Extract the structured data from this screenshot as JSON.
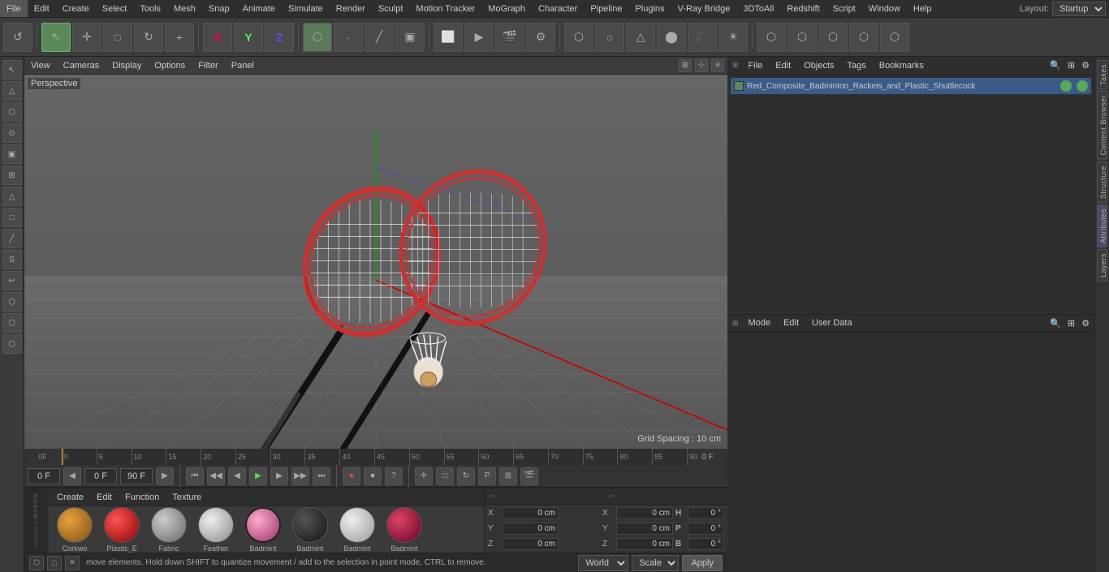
{
  "menubar": {
    "items": [
      "File",
      "Edit",
      "Create",
      "Select",
      "Tools",
      "Mesh",
      "Snap",
      "Animate",
      "Simulate",
      "Render",
      "Sculpt",
      "Motion Tracker",
      "MoGraph",
      "Character",
      "Pipeline",
      "Plugins",
      "V-Ray Bridge",
      "3DToAll",
      "Redshift",
      "Script",
      "Window",
      "Help"
    ],
    "layout_label": "Layout:",
    "layout_value": "Startup"
  },
  "toolbar": {
    "undo_label": "↺",
    "mode_buttons": [
      "↖",
      "✛",
      "□",
      "↻",
      "+",
      "X",
      "Y",
      "Z",
      "⊙",
      "⊘",
      "⊕",
      "⬡",
      "…",
      "🎬",
      "🎬",
      "🎬",
      "⬡",
      "⬡",
      "⬡",
      "⬡",
      "⬡",
      "☀"
    ]
  },
  "viewport": {
    "label": "Perspective",
    "header_menus": [
      "View",
      "Cameras",
      "Display",
      "Options",
      "Filter",
      "Panel"
    ],
    "grid_spacing": "Grid Spacing : 10 cm"
  },
  "objects_panel": {
    "toolbar_items": [
      "File",
      "Edit",
      "Objects",
      "Tags",
      "Bookmarks"
    ],
    "object_name": "Red_Composite_Badminton_Rackets_and_Plastic_Shuttlecock",
    "obj_color": "#5a8a5a"
  },
  "attributes_panel": {
    "toolbar_items": [
      "Mode",
      "Edit",
      "User Data"
    ],
    "x_pos": "0 cm",
    "y_pos": "0 cm",
    "z_pos": "0 cm",
    "x_scale": "0 cm",
    "y_scale": "0 cm",
    "z_scale": "0 cm",
    "h_rot": "0 °",
    "p_rot": "0 °",
    "b_rot": "0 °"
  },
  "right_tabs": [
    "Takes",
    "Content Browser",
    "Structure",
    "Attributes",
    "Layers"
  ],
  "timeline": {
    "ticks": [
      0,
      5,
      10,
      15,
      20,
      25,
      30,
      35,
      40,
      45,
      50,
      55,
      60,
      65,
      70,
      75,
      80,
      85,
      90
    ],
    "frame_label": "0 F",
    "end_frame": "90 F",
    "playback_frame": "0 F"
  },
  "playback": {
    "frame_start": "0 F",
    "frame_end": "90 F",
    "current": "0 F",
    "buttons": [
      "⏮",
      "◀◀",
      "◀",
      "▶",
      "▶▶",
      "⏭",
      "⏺",
      "⏹",
      "?",
      "✛",
      "□",
      "↻",
      "P",
      "⊞",
      "□"
    ]
  },
  "materials": {
    "toolbar_items": [
      "Create",
      "Edit",
      "Function",
      "Texture"
    ],
    "items": [
      {
        "name": "Corkwo",
        "color": "#c8841a",
        "type": "cork"
      },
      {
        "name": "Plastic_E",
        "color": "#e02020",
        "type": "plastic"
      },
      {
        "name": "Fabric",
        "color": "#aaaaaa",
        "type": "fabric"
      },
      {
        "name": "Feather",
        "color": "#cccccc",
        "type": "feather"
      },
      {
        "name": "Badmint",
        "color": "#e07090",
        "type": "badmint1"
      },
      {
        "name": "Badmint",
        "color": "#333333",
        "type": "badmint2"
      },
      {
        "name": "Badmint",
        "color": "#cccccc",
        "type": "badmint3"
      },
      {
        "name": "Badmint",
        "color": "#c03050",
        "type": "badmint4"
      }
    ]
  },
  "coords": {
    "labels": {
      "x": "X",
      "y": "Y",
      "z": "Z",
      "h": "H",
      "p": "P",
      "b": "B"
    },
    "pos_label": "--",
    "size_label": "--",
    "x_pos": "0 cm",
    "y_pos": "0 cm",
    "z_pos": "0 cm",
    "x_size": "0 cm",
    "y_size": "0 cm",
    "z_size": "0 cm",
    "h_val": "0 °",
    "p_val": "0 °",
    "b_val": "0 °",
    "world_label": "World",
    "scale_label": "Scale",
    "apply_label": "Apply"
  },
  "status_bar": {
    "message": "move elements. Hold down SHIFT to quantize movement / add to the selection in point mode, CTRL to remove."
  },
  "maxon": {
    "logo_text": "MAXON",
    "c4d_text": "CINEMA 4D"
  }
}
